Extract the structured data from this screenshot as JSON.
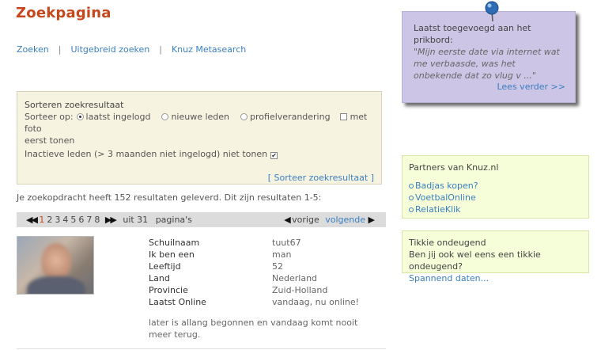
{
  "page": {
    "title": "Zoekpagina"
  },
  "nav": {
    "items": [
      "Zoeken",
      "Uitgebreid zoeken",
      "Knuz Metasearch"
    ],
    "separator": "|"
  },
  "sort": {
    "title": "Sorteren zoekresultaat",
    "prefix": "Sorteer op:",
    "options": [
      "laatst ingelogd",
      "nieuwe leden",
      "profielverandering"
    ],
    "selected": "laatst ingelogd",
    "photo_label": "met foto",
    "photo_label_cont": "eerst tonen",
    "inactive_label": "Inactieve leden (> 3 maanden niet ingelogd) niet tonen",
    "inactive_checked": true,
    "submit": "[ Sorteer zoekresultaat ]"
  },
  "results": {
    "summary": "Je zoekopdracht heeft 152 resultaten geleverd. Dit zijn resultaten 1-5:"
  },
  "pager": {
    "pages": [
      "1",
      "2",
      "3",
      "4",
      "5",
      "6",
      "7",
      "8"
    ],
    "current": "1",
    "of_text": "uit 31",
    "pages_label": "pagina's",
    "prev": "vorige",
    "next": "volgende"
  },
  "result": {
    "fields": [
      {
        "label": "Schuilnaam",
        "value": "tuut67",
        "link": true
      },
      {
        "label": "Ik ben een",
        "value": "man"
      },
      {
        "label": "Leeftijd",
        "value": "52"
      },
      {
        "label": "Land",
        "value": "Nederland"
      },
      {
        "label": "Provincie",
        "value": "Zuid-Holland"
      },
      {
        "label": "Laatst Online",
        "value": "vandaag, nu online!"
      }
    ],
    "bio": "later is allang begonnen en vandaag komt nooit meer terug."
  },
  "note": {
    "title": "Laatst toegevoegd aan het prikbord:",
    "quote": "\"Mijn eerste date via internet wat me verbaasde, was het onbekende dat zo vlug v ...\"",
    "more": "Lees verder >>"
  },
  "partners": {
    "title": "Partners van Knuz.nl",
    "links": [
      "Badjas kopen?",
      "VoetbalOnline",
      "RelatieKlik"
    ]
  },
  "tikkie": {
    "title": "Tikkie ondeugend",
    "text": "Ben jij ook wel eens een tikkie ondeugend?",
    "link": "Spannend daten..."
  },
  "colors": {
    "accent": "#c5471b",
    "link": "#3a7fc1",
    "note_bg": "#ccc5e6",
    "box_bg": "#f6fdd9",
    "sort_bg": "#f7f3e1"
  },
  "icons": {
    "pin": "pushpin-icon",
    "arrows": [
      "arrow-left-icon",
      "arrow-right-icon"
    ]
  }
}
